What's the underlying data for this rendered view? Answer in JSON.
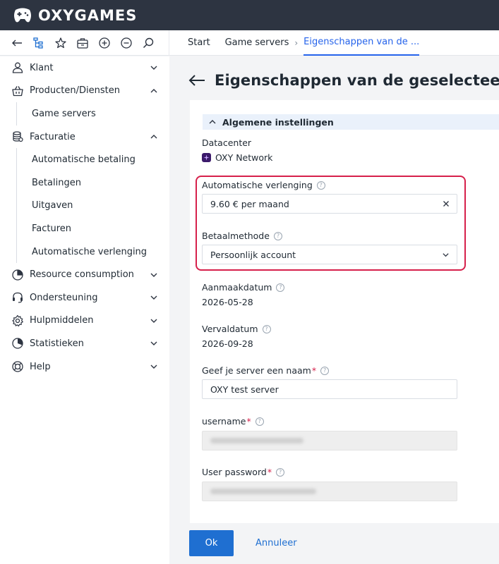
{
  "brand": {
    "logo_text": "OXYGAMES"
  },
  "toolbar": {
    "icons": [
      "back-icon",
      "tree-icon",
      "star-icon",
      "briefcase-icon",
      "zoom-in-icon",
      "zoom-out-icon",
      "search-icon"
    ]
  },
  "breadcrumb": {
    "items": [
      "Start",
      "Game servers",
      "Eigenschappen van de ..."
    ]
  },
  "sidebar": {
    "klant": "Klant",
    "producten": "Producten/Diensten",
    "game_servers": "Game servers",
    "facturatie": "Facturatie",
    "automatische_betaling": "Automatische betaling",
    "betalingen": "Betalingen",
    "uitgaven": "Uitgaven",
    "facturen": "Facturen",
    "automatische_verlenging": "Automatische verlenging",
    "resource": "Resource consumption",
    "ondersteuning": "Ondersteuning",
    "hulpmiddelen": "Hulpmiddelen",
    "statistieken": "Statistieken",
    "help": "Help"
  },
  "main": {
    "title": "Eigenschappen van de geselecteerde server",
    "section_title": "Algemene instellingen",
    "datacenter_label": "Datacenter",
    "datacenter_value": "OXY Network",
    "auto_renew_label": "Automatische verlenging",
    "auto_renew_value": "9.60 € per maand",
    "payment_label": "Betaalmethode",
    "payment_value": "Persoonlijk account",
    "created_label": "Aanmaakdatum",
    "created_value": "2026-05-28",
    "expiry_label": "Vervaldatum",
    "expiry_value": "2026-09-28",
    "name_label": "Geef je server een naam",
    "name_value": "OXY test server",
    "username_label": "username",
    "password_label": "User password",
    "required_mark": "*",
    "help_mark": "?"
  },
  "actions": {
    "ok": "Ok",
    "cancel": "Annuleer"
  },
  "colors": {
    "accent": "#1f6fd1",
    "highlight": "#d6204b",
    "header": "#2d3441"
  }
}
